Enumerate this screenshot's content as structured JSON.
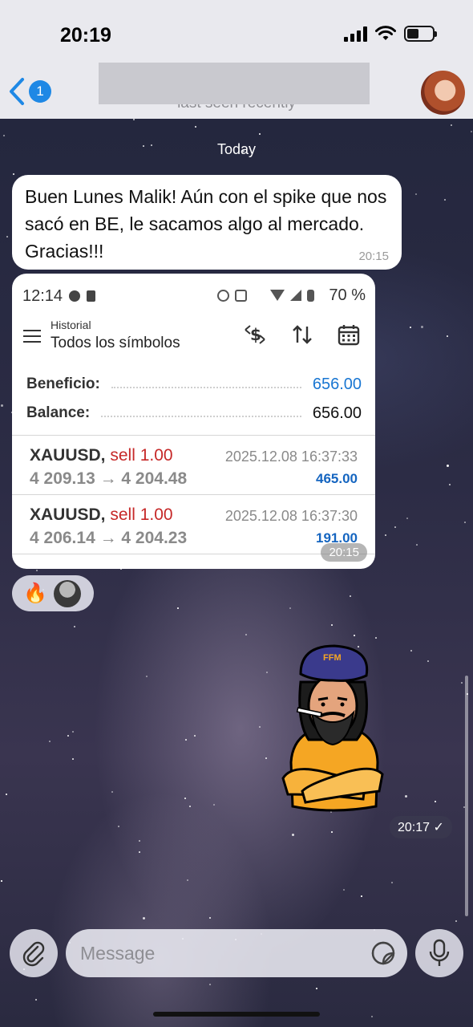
{
  "status_bar": {
    "time": "20:19"
  },
  "header": {
    "back_badge": "1",
    "last_seen": "last seen recently",
    "icons": [
      "back-chevron-icon",
      "avatar"
    ]
  },
  "chat": {
    "date_divider": "Today",
    "incoming_message": {
      "text": "Buen Lunes Malik! Aún con el spike que nos sacó en BE, le sacamos algo al mercado. Gracias!!!",
      "time": "20:15"
    },
    "screenshot_message": {
      "time": "20:15",
      "phone_status": {
        "time": "12:14",
        "battery": "70 %"
      },
      "app_header": {
        "subtitle": "Historial",
        "title": "Todos los símbolos"
      },
      "summary": [
        {
          "label": "Beneficio:",
          "value": "656.00",
          "color": "#1976d2"
        },
        {
          "label": "Balance:",
          "value": "656.00",
          "color": "#111111"
        }
      ],
      "trades": [
        {
          "symbol": "XAUUSD,",
          "side": "sell 1.00",
          "prices": "4 209.13 → 4 204.48",
          "date": "2025.12.08 16:37:33",
          "profit": "465.00"
        },
        {
          "symbol": "XAUUSD,",
          "side": "sell 1.00",
          "prices": "4 206.14 → 4 204.23",
          "date": "2025.12.08 16:37:30",
          "profit": "191.00"
        }
      ]
    },
    "reactions": {
      "emoji": "🔥"
    },
    "sticker_message": {
      "text": "FFM",
      "time": "20:17",
      "status": "✓"
    }
  },
  "composer": {
    "placeholder": "Message"
  }
}
